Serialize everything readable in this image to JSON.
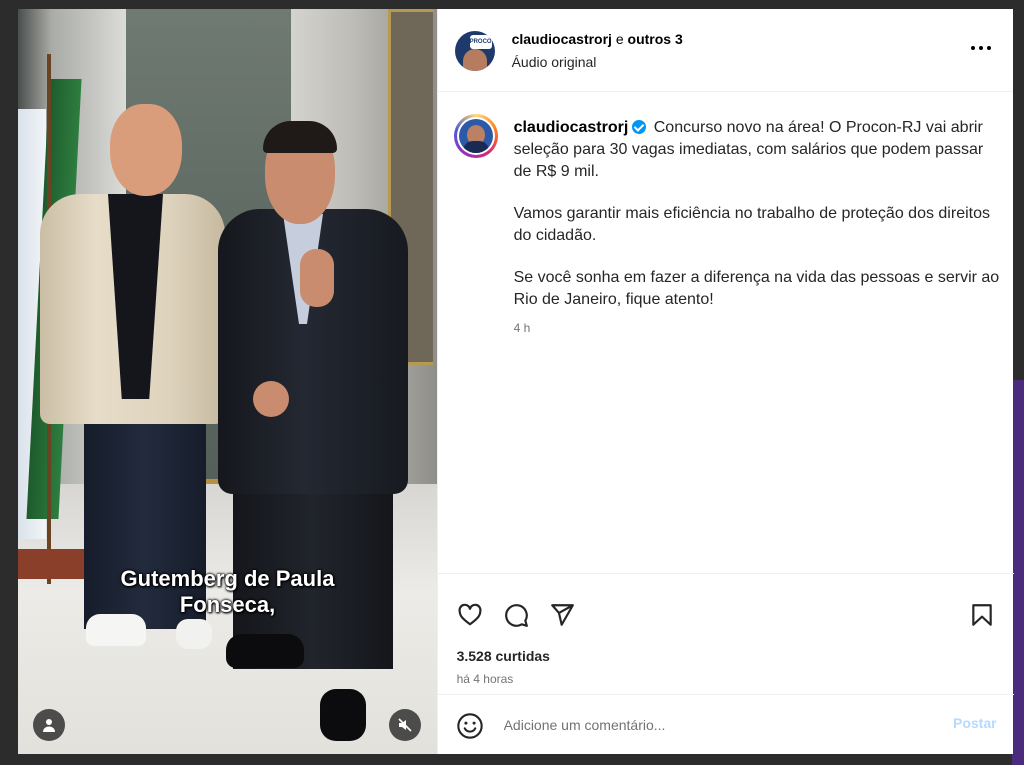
{
  "video": {
    "caption_line1": "Gutemberg de Paula",
    "caption_line2": "Fonseca,"
  },
  "header": {
    "username": "claudiocastrorj",
    "connector": "e",
    "others": "outros 3",
    "audio": "Áudio original",
    "avatar_badge": "PROCON"
  },
  "caption": {
    "username": "claudiocastrorj",
    "line1": "Concurso novo na área! O Procon-RJ vai abrir seleção para 30 vagas imediatas, com salários que podem passar de R$ 9 mil.",
    "line2": "Vamos garantir mais eficiência no trabalho de proteção dos direitos do cidadão.",
    "line3": "Se você sonha em fazer a diferença na vida das pessoas e servir ao Rio de Janeiro, fique atento!",
    "time": "4 h"
  },
  "stats": {
    "likes": "3.528 curtidas",
    "posted": "há 4 horas"
  },
  "comment": {
    "placeholder": "Adicione um comentário...",
    "post_label": "Postar"
  },
  "colors": {
    "accent": "#0095f6",
    "post_disabled": "#b3dbff",
    "muted_text": "#737373"
  }
}
